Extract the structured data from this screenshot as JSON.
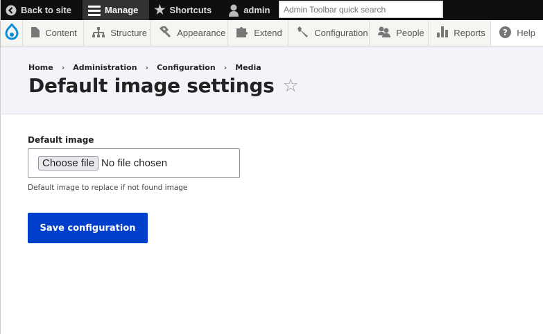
{
  "toolbar": {
    "back": "Back to site",
    "manage": "Manage",
    "shortcuts": "Shortcuts",
    "user": "admin",
    "search_placeholder": "Admin Toolbar quick search"
  },
  "menu": [
    {
      "label": "Content",
      "icon": "file-icon"
    },
    {
      "label": "Structure",
      "icon": "sitemap-icon"
    },
    {
      "label": "Appearance",
      "icon": "paintbrush-icon"
    },
    {
      "label": "Extend",
      "icon": "puzzle-icon"
    },
    {
      "label": "Configuration",
      "icon": "wrench-icon"
    },
    {
      "label": "People",
      "icon": "people-icon"
    },
    {
      "label": "Reports",
      "icon": "bar-chart-icon"
    },
    {
      "label": "Help",
      "icon": "help-icon"
    }
  ],
  "breadcrumb": [
    "Home",
    "Administration",
    "Configuration",
    "Media"
  ],
  "breadcrumb_sep": "›",
  "page_title": "Default image settings",
  "form": {
    "label": "Default image",
    "choose": "Choose file",
    "no_file": "No file chosen",
    "description": "Default image to replace if not found image",
    "save": "Save configuration"
  },
  "colors": {
    "accent": "#003ecc",
    "drupal_blue": "#0a8cd6"
  }
}
